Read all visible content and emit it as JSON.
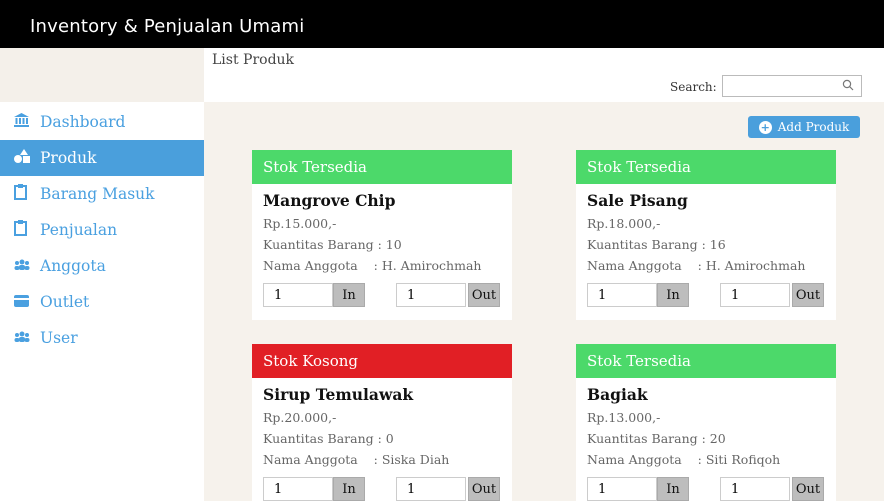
{
  "app": {
    "title": "Inventory & Penjualan Umami"
  },
  "page": {
    "title": "List Produk"
  },
  "search": {
    "label": "Search:",
    "value": ""
  },
  "sidebar": {
    "items": [
      {
        "label": "Dashboard",
        "icon": "bank-icon"
      },
      {
        "label": "Produk",
        "icon": "shapes-icon",
        "active": true
      },
      {
        "label": "Barang Masuk",
        "icon": "clipboard-icon"
      },
      {
        "label": "Penjualan",
        "icon": "clipboard-icon"
      },
      {
        "label": "Anggota",
        "icon": "users-icon"
      },
      {
        "label": "Outlet",
        "icon": "card-icon"
      },
      {
        "label": "User",
        "icon": "users-icon"
      }
    ]
  },
  "toolbar": {
    "add_label": "Add Produk"
  },
  "colors": {
    "accent": "#4a9fdc",
    "in_stock": "#4cd96a",
    "out_of_stock": "#e11f25"
  },
  "products": [
    {
      "status": "Stok Tersedia",
      "name": "Mangrove Chip",
      "price": "Rp.15.000,-",
      "qty_text": "Kuantitas Barang : 10",
      "member_text": "Nama Anggota    : H. Amirochmah",
      "in_value": "1",
      "out_value": "1",
      "in_label": "In",
      "out_label": "Out"
    },
    {
      "status": "Stok Tersedia",
      "name": "Sale Pisang",
      "price": "Rp.18.000,-",
      "qty_text": "Kuantitas Barang : 16",
      "member_text": "Nama Anggota    : H. Amirochmah",
      "in_value": "1",
      "out_value": "1",
      "in_label": "In",
      "out_label": "Out"
    },
    {
      "status": "Stok Kosong",
      "name": "Sirup Temulawak",
      "price": "Rp.20.000,-",
      "qty_text": "Kuantitas Barang : 0",
      "member_text": "Nama Anggota    : Siska Diah",
      "in_value": "1",
      "out_value": "1",
      "in_label": "In",
      "out_label": "Out"
    },
    {
      "status": "Stok Tersedia",
      "name": "Bagiak",
      "price": "Rp.13.000,-",
      "qty_text": "Kuantitas Barang : 20",
      "member_text": "Nama Anggota    : Siti Rofiqoh",
      "in_value": "1",
      "out_value": "1",
      "in_label": "In",
      "out_label": "Out"
    }
  ]
}
